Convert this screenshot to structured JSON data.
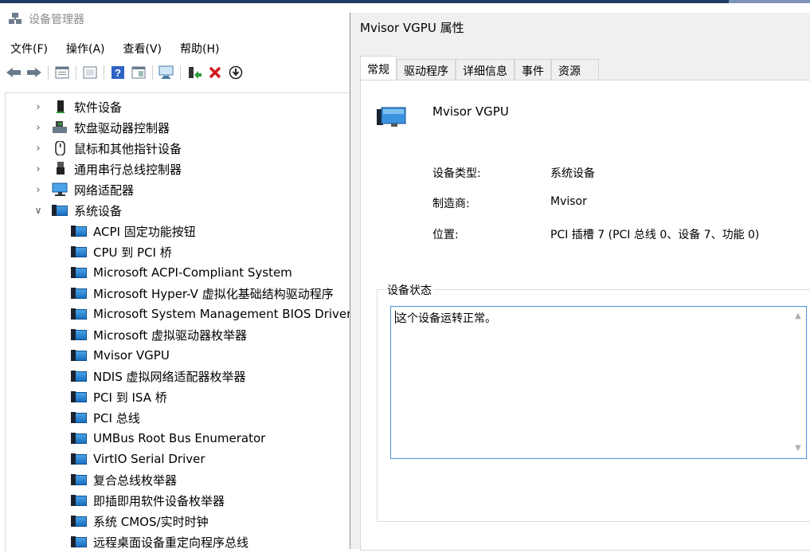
{
  "device_manager": {
    "title": "设备管理器",
    "menu": [
      "文件(F)",
      "操作(A)",
      "查看(V)",
      "帮助(H)"
    ],
    "toolbar_icons": [
      "back-arrow-icon",
      "forward-arrow-icon",
      "properties-icon",
      "update-icon",
      "help-icon",
      "view-icon",
      "scan-hardware-icon",
      "enable-device-icon",
      "uninstall-icon",
      "download-icon"
    ],
    "tree": [
      {
        "label": "软件设备",
        "expanded": false,
        "icon": "software-device-icon"
      },
      {
        "label": "软盘驱动器控制器",
        "expanded": false,
        "icon": "floppy-controller-icon"
      },
      {
        "label": "鼠标和其他指针设备",
        "expanded": false,
        "icon": "mouse-icon"
      },
      {
        "label": "通用串行总线控制器",
        "expanded": false,
        "icon": "usb-icon"
      },
      {
        "label": "网络适配器",
        "expanded": false,
        "icon": "network-adapter-icon"
      },
      {
        "label": "系统设备",
        "expanded": true,
        "icon": "system-device-icon"
      }
    ],
    "system_devices": [
      "ACPI 固定功能按钮",
      "CPU 到 PCI 桥",
      "Microsoft ACPI-Compliant System",
      "Microsoft Hyper-V 虚拟化基础结构驱动程序",
      "Microsoft System Management BIOS Driver",
      "Microsoft 虚拟驱动器枚举器",
      "Mvisor VGPU",
      "NDIS 虚拟网络适配器枚举器",
      "PCI 到 ISA 桥",
      "PCI 总线",
      "UMBus Root Bus Enumerator",
      "VirtIO Serial Driver",
      "复合总线枚举器",
      "即插即用软件设备枚举器",
      "系统 CMOS/实时时钟",
      "远程桌面设备重定向程序总线"
    ]
  },
  "properties": {
    "title": "Mvisor VGPU 属性",
    "tabs": [
      "常规",
      "驱动程序",
      "详细信息",
      "事件",
      "资源"
    ],
    "active_tab": "常规",
    "device_name": "Mvisor VGPU",
    "fields": {
      "type_label": "设备类型:",
      "type_value": "系统设备",
      "mfr_label": "制造商:",
      "mfr_value": "Mvisor",
      "loc_label": "位置:",
      "loc_value": "PCI 插槽 7 (PCI 总线 0、设备 7、功能 0)"
    },
    "status_caption": "设备状态",
    "status_text": "这个设备运转正常。"
  }
}
